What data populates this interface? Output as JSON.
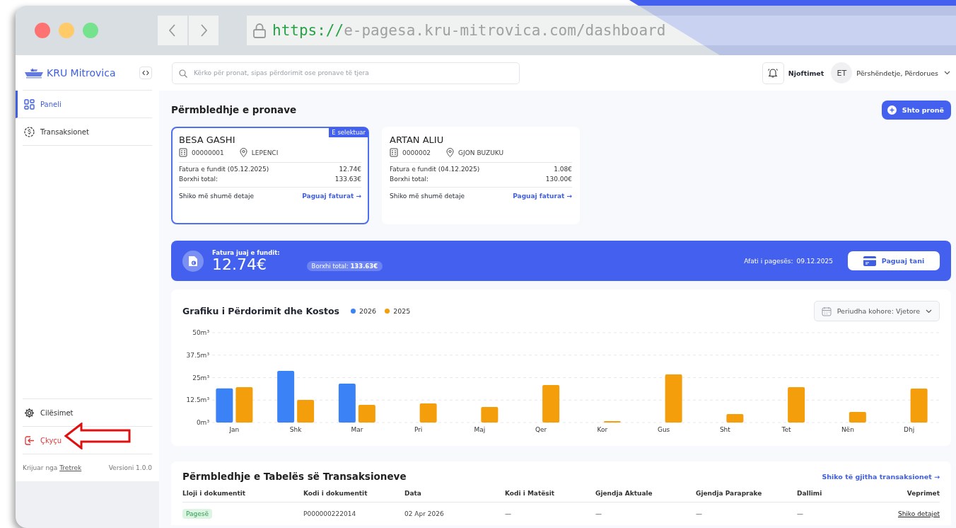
{
  "browser": {
    "url": {
      "scheme": "https://",
      "rest": "e-pagesa.kru-mitrovica.com/dashboard"
    }
  },
  "sidebar": {
    "brand": "KRU Mitrovica",
    "items": [
      {
        "label": "Paneli",
        "selected": true
      },
      {
        "label": "Transaksionet",
        "selected": false
      }
    ],
    "bottom_items": [
      {
        "label": "Cilësimet",
        "kind": "normal"
      },
      {
        "label": "Çkyçu",
        "kind": "danger"
      }
    ],
    "footer": {
      "credit": "Krijuar nga ",
      "credit_link": "Tretrek",
      "version": "Versioni 1.0.0"
    }
  },
  "topbar": {
    "search": {
      "placeholder": "Kërko për pronat, sipas përdorimit ose pronave të tjera"
    },
    "notifications": "Njoftimet",
    "avatar": "ET",
    "greeting": "Përshëndetje, Përdorues"
  },
  "properties": {
    "title": "Përmbledhje e pronave",
    "add_button": "Shto pronë",
    "selected_badge": "E selektuar",
    "cards": [
      {
        "name": "BESA GASHI",
        "code": "00000001",
        "location": "LEPENCI",
        "last_invoice_label": "Fatura e fundit (05.12.2025)",
        "last_invoice": "12.74€",
        "debt_label": "Borxhi total:",
        "debt": "133.63€",
        "details": "Shiko më shumë detaje",
        "pay": "Paguaj faturat →",
        "selected": true
      },
      {
        "name": "ARTAN ALIU",
        "code": "0000002",
        "location": "GJON BUZUKU",
        "last_invoice_label": "Fatura e fundit (04.12.2025)",
        "last_invoice": "1.08€",
        "debt_label": "Borxhi total:",
        "debt": "130.00€",
        "details": "Shiko më shumë detaje",
        "pay": "Paguaj faturat →",
        "selected": false
      }
    ]
  },
  "invoice_banner": {
    "label": "Fatura juaj e fundit:",
    "amount": "12.74€",
    "debt": "Borxhi total: **133.63€**",
    "due_label": "Afati i pagesës:",
    "due_date": "09.12.2025",
    "pay_button": "Paguaj tani"
  },
  "chart": {
    "title": "Grafiku i Përdorimit dhe Kostos",
    "period": "Periudha kohore: Vjetore",
    "chart_data": {
      "type": "bar",
      "categories": [
        "Jan",
        "Shk",
        "Mar",
        "Pri",
        "Maj",
        "Qer",
        "Kor",
        "Gus",
        "Sht",
        "Tet",
        "Nën",
        "Dhj"
      ],
      "series": [
        {
          "name": "2026",
          "color": "#3b82f6",
          "values": [
            19,
            28.7,
            21.7,
            null,
            null,
            null,
            null,
            null,
            null,
            null,
            null,
            null
          ]
        },
        {
          "name": "2025",
          "color": "#f59e0b",
          "values": [
            19.7,
            12.6,
            9.8,
            10.6,
            8.7,
            20.9,
            0.8,
            26.8,
            4.7,
            19.7,
            5.9,
            18.9
          ]
        }
      ],
      "ylim": [
        0,
        50
      ],
      "grid": true,
      "yticks": [
        {
          "value": 0,
          "label": "0m³"
        },
        {
          "value": 12.5,
          "label": "12.5m³"
        },
        {
          "value": 25,
          "label": "25m³"
        },
        {
          "value": 37.5,
          "label": "37.5m³"
        },
        {
          "value": 50,
          "label": "50m³"
        }
      ]
    }
  },
  "transactions": {
    "title": "Përmbledhje e Tabelës së Transaksioneve",
    "see_all": "Shiko të gjitha transaksionet →",
    "columns": [
      "Lloji i dokumentit",
      "Kodi i dokumentit",
      "Data",
      "Kodi i Matësit",
      "Gjendja Aktuale",
      "Gjendja Paraprake",
      "Dallimi",
      "Veprimet"
    ],
    "rows": [
      {
        "type": "Pagesë",
        "code": "P000000222014",
        "date": "02 Apr 2026",
        "meter": "—",
        "current": "—",
        "previous": "—",
        "difference": "—",
        "action": "Shiko detajet"
      }
    ]
  },
  "annotation": {
    "kind": "arrow"
  }
}
